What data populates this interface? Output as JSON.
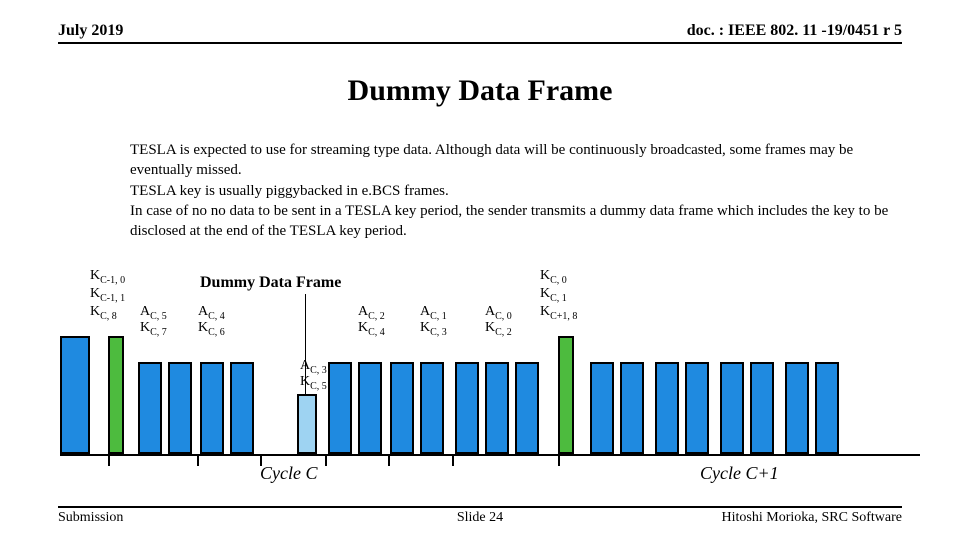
{
  "header": {
    "left": "July 2019",
    "right": "doc. : IEEE 802. 11 -19/0451 r 5"
  },
  "title": "Dummy Data Frame",
  "paragraph": "TESLA is expected to use for streaming type data. Although data will be continuously broadcasted, some frames may be eventually missed.\nTESLA key is usually piggybacked in e.BCS frames.\nIn case of no no data to be sent in a TESLA key period, the sender transmits a dummy data frame which includes the key to be disclosed at the end of the TESLA key period.",
  "dummy_label": "Dummy Data Frame",
  "left_keys": {
    "l1": "K",
    "l1s": "C-1, 0",
    "l2": "K",
    "l2s": "C-1, 1",
    "l3": "K",
    "l3s": "C, 8"
  },
  "right_keys": {
    "r1": "K",
    "r1s": "C, 0",
    "r2": "K",
    "r2s": "C, 1",
    "r3": "K",
    "r3s": "C+1, 8"
  },
  "labels": {
    "ac5": "A",
    "ac5s": "C, 5",
    "kc7": "K",
    "kc7s": "C, 7",
    "ac4": "A",
    "ac4s": "C, 4",
    "kc6": "K",
    "kc6s": "C, 6",
    "ac3": "A",
    "ac3s": "C, 3",
    "kc5": "K",
    "kc5s": "C, 5",
    "ac2": "A",
    "ac2s": "C, 2",
    "kc4": "K",
    "kc4s": "C, 4",
    "ac1": "A",
    "ac1s": "C, 1",
    "kc3": "K",
    "kc3s": "C, 3",
    "ac0": "A",
    "ac0s": "C, 0",
    "kc2": "K",
    "kc2s": "C, 2"
  },
  "cycles": {
    "c": "Cycle  C",
    "c1": "Cycle  C+1"
  },
  "footer": {
    "left": "Submission",
    "mid": "Slide 24",
    "right": "Hitoshi Morioka, SRC Software"
  }
}
